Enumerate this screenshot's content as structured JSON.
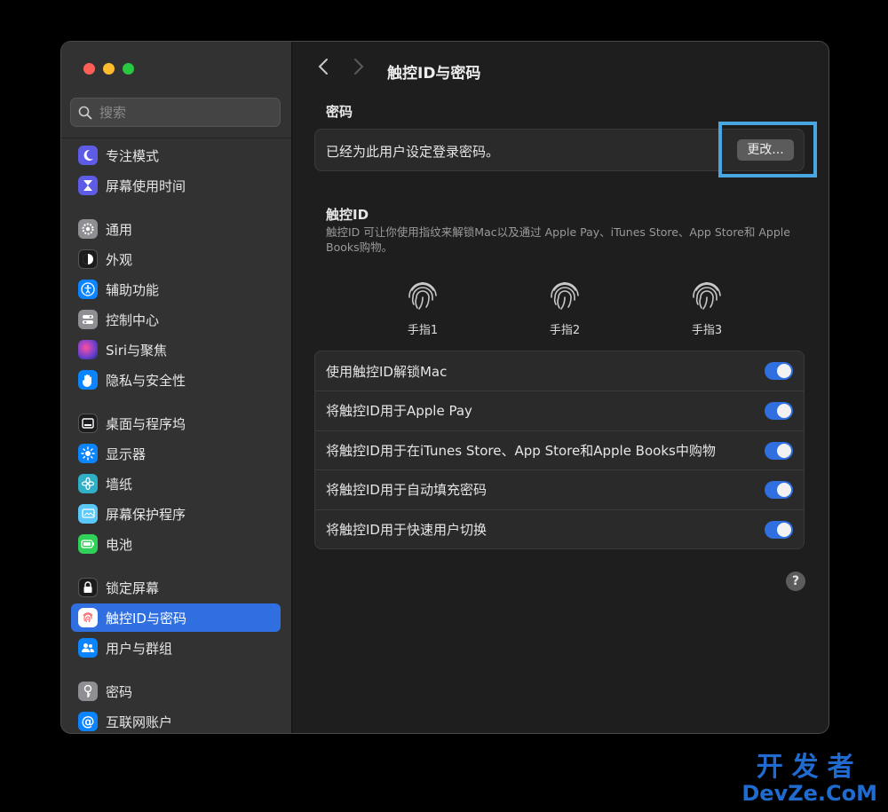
{
  "sidebar": {
    "search_placeholder": "搜索",
    "items": [
      {
        "label": "专注模式",
        "icon": "moon-icon",
        "color": "#5e5ce6"
      },
      {
        "label": "屏幕使用时间",
        "icon": "hourglass-icon",
        "color": "#5e5ce6"
      },
      {
        "label": "通用",
        "icon": "gear-icon",
        "color": "#8e8e93"
      },
      {
        "label": "外观",
        "icon": "appearance-icon",
        "color": "#1c1c1e"
      },
      {
        "label": "辅助功能",
        "icon": "accessibility-icon",
        "color": "#0a84ff"
      },
      {
        "label": "控制中心",
        "icon": "control-center-icon",
        "color": "#8e8e93"
      },
      {
        "label": "Siri与聚焦",
        "icon": "siri-icon",
        "color": "#6a3fd0"
      },
      {
        "label": "隐私与安全性",
        "icon": "hand-icon",
        "color": "#0a84ff"
      },
      {
        "label": "桌面与程序坞",
        "icon": "dock-icon",
        "color": "#1c1c1e"
      },
      {
        "label": "显示器",
        "icon": "sun-icon",
        "color": "#0a84ff"
      },
      {
        "label": "墙纸",
        "icon": "flower-icon",
        "color": "#30b0c7"
      },
      {
        "label": "屏幕保护程序",
        "icon": "screensaver-icon",
        "color": "#5ac8fa"
      },
      {
        "label": "电池",
        "icon": "battery-icon",
        "color": "#30d158"
      },
      {
        "label": "锁定屏幕",
        "icon": "lock-icon",
        "color": "#1c1c1e"
      },
      {
        "label": "触控ID与密码",
        "icon": "fingerprint-icon",
        "color": "#ff6b6b"
      },
      {
        "label": "用户与群组",
        "icon": "users-icon",
        "color": "#0a84ff"
      },
      {
        "label": "密码",
        "icon": "key-icon",
        "color": "#8e8e93"
      },
      {
        "label": "互联网账户",
        "icon": "at-icon",
        "color": "#0a84ff"
      }
    ]
  },
  "main": {
    "title": "触控ID与密码",
    "password_section": {
      "heading": "密码",
      "status": "已经为此用户设定登录密码。",
      "button": "更改..."
    },
    "touchid_section": {
      "heading": "触控ID",
      "description": "触控ID 可让你使用指纹来解锁Mac以及通过 Apple Pay、iTunes Store、App Store和 Apple Books购物。",
      "fingers": [
        "手指1",
        "手指2",
        "手指3"
      ]
    },
    "toggles": [
      {
        "label": "使用触控ID解锁Mac",
        "on": true
      },
      {
        "label": "将触控ID用于Apple Pay",
        "on": true
      },
      {
        "label": "将触控ID用于在iTunes Store、App Store和Apple Books中购物",
        "on": true
      },
      {
        "label": "将触控ID用于自动填充密码",
        "on": true
      },
      {
        "label": "将触控ID用于快速用户切换",
        "on": true
      }
    ],
    "help": "?"
  },
  "watermark": {
    "line1": "开发者",
    "line2": "DevZe.CoM"
  }
}
